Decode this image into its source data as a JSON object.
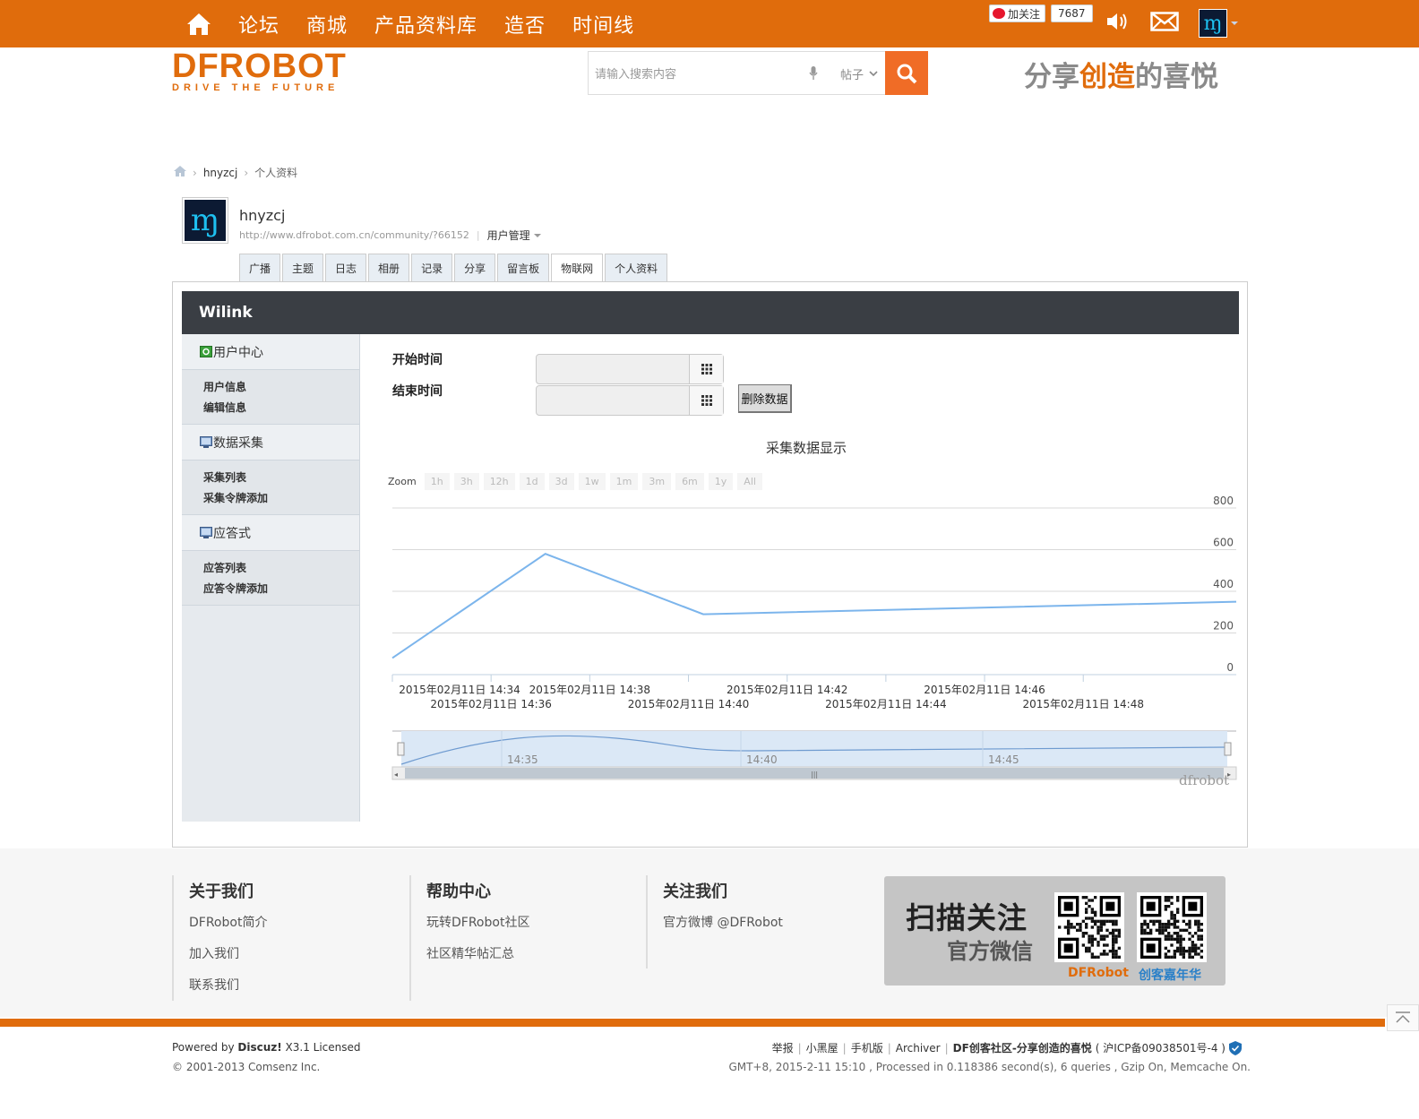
{
  "nav": {
    "items": [
      "论坛",
      "商城",
      "产品资料库",
      "造否",
      "时间线"
    ],
    "weibo_follow": "加关注",
    "weibo_count": "7687"
  },
  "header": {
    "logo_main": "DFROBOT",
    "logo_sub": "DRIVE THE FUTURE",
    "search_placeholder": "请输入搜索内容",
    "search_type": "帖子",
    "slogan_1": "分享",
    "slogan_2": "创造",
    "slogan_3": "的喜悦"
  },
  "breadcrumb": {
    "user": "hnyzcj",
    "page": "个人资料"
  },
  "profile": {
    "name": "hnyzcj",
    "url": "http://www.dfrobot.com.cn/community/?66152",
    "manage": "用户管理",
    "tabs": [
      "广播",
      "主题",
      "日志",
      "相册",
      "记录",
      "分享",
      "留言板",
      "物联网",
      "个人资料"
    ],
    "active_tab": "物联网"
  },
  "panel": {
    "title": "Wilink",
    "sections": [
      {
        "title": "用户中心",
        "items": [
          "用户信息",
          "编辑信息"
        ]
      },
      {
        "title": "数据采集",
        "items": [
          "采集列表",
          "采集令牌添加"
        ]
      },
      {
        "title": "应答式",
        "items": [
          "应答列表",
          "应答令牌添加"
        ]
      }
    ],
    "start_label": "开始时间",
    "end_label": "结束时间",
    "start_value": "",
    "end_value": "",
    "delete_button": "删除数据"
  },
  "chart_data": {
    "type": "line",
    "title": "采集数据显示",
    "zoom_label": "Zoom",
    "zoom_buttons": [
      "1h",
      "3h",
      "12h",
      "1d",
      "3d",
      "1w",
      "1m",
      "3m",
      "6m",
      "1y",
      "All"
    ],
    "x": [
      "2015年02月11日 14:34",
      "2015年02月11日 14:37",
      "2015年02月11日 14:40",
      "2015年02月11日 14:48"
    ],
    "x_minutes": [
      34,
      37.1,
      40.3,
      51.1
    ],
    "values": [
      80,
      580,
      290,
      350
    ],
    "ylim": [
      0,
      800
    ],
    "y_ticks": [
      0,
      200,
      400,
      600,
      800
    ],
    "x_tick_labels": [
      "2015年02月11日 14:34",
      "2015年02月11日 14:36",
      "2015年02月11日 14:38",
      "2015年02月11日 14:40",
      "2015年02月11日 14:42",
      "2015年02月11日 14:44",
      "2015年02月11日 14:46",
      "2015年02月11日 14:48"
    ],
    "navigator_labels": [
      "14:35",
      "14:40",
      "14:45"
    ],
    "grid": true,
    "line_color": "#7cb5ec",
    "credit": "dfrobot"
  },
  "footer": {
    "cols": [
      {
        "title": "关于我们",
        "links": [
          "DFRobot简介",
          "加入我们",
          "联系我们"
        ]
      },
      {
        "title": "帮助中心",
        "links": [
          "玩转DFRobot社区",
          "社区精华帖汇总"
        ]
      },
      {
        "title": "关注我们",
        "links": [
          "官方微博 @DFRobot"
        ]
      }
    ],
    "qr_big": "扫描关注",
    "qr_small": "官方微信",
    "qr_cap1": "DFRobot",
    "qr_cap2": "创客嘉年华",
    "powered_prefix": "Powered by ",
    "powered_brand": "Discuz!",
    "powered_suffix": " X3.1 Licensed",
    "copyright": "© 2001-2013 Comsenz Inc.",
    "links": [
      "举报",
      "小黑屋",
      "手机版",
      "Archiver"
    ],
    "site_title": "DF创客社区-分享创造的喜悦",
    "icp": "( 沪ICP备09038501号-4 )",
    "stats": "GMT+8, 2015-2-11 15:10 , Processed in 0.118386 second(s), 6 queries , Gzip On, Memcache On."
  },
  "colors": {
    "brand": "#e06c0c",
    "search_btn": "#f06c26",
    "header_dark": "#3a3e44"
  }
}
